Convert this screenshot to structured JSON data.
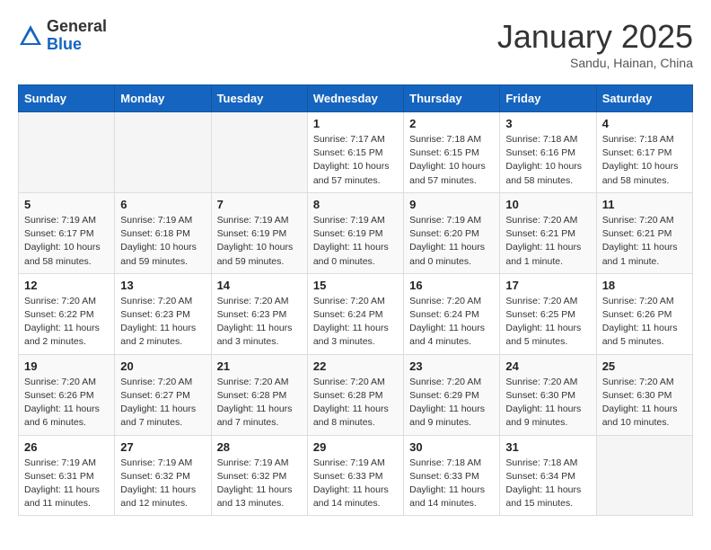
{
  "header": {
    "logo_general": "General",
    "logo_blue": "Blue",
    "month_title": "January 2025",
    "location": "Sandu, Hainan, China"
  },
  "days_of_week": [
    "Sunday",
    "Monday",
    "Tuesday",
    "Wednesday",
    "Thursday",
    "Friday",
    "Saturday"
  ],
  "weeks": [
    [
      {
        "day": "",
        "info": ""
      },
      {
        "day": "",
        "info": ""
      },
      {
        "day": "",
        "info": ""
      },
      {
        "day": "1",
        "info": "Sunrise: 7:17 AM\nSunset: 6:15 PM\nDaylight: 10 hours and 57 minutes."
      },
      {
        "day": "2",
        "info": "Sunrise: 7:18 AM\nSunset: 6:15 PM\nDaylight: 10 hours and 57 minutes."
      },
      {
        "day": "3",
        "info": "Sunrise: 7:18 AM\nSunset: 6:16 PM\nDaylight: 10 hours and 58 minutes."
      },
      {
        "day": "4",
        "info": "Sunrise: 7:18 AM\nSunset: 6:17 PM\nDaylight: 10 hours and 58 minutes."
      }
    ],
    [
      {
        "day": "5",
        "info": "Sunrise: 7:19 AM\nSunset: 6:17 PM\nDaylight: 10 hours and 58 minutes."
      },
      {
        "day": "6",
        "info": "Sunrise: 7:19 AM\nSunset: 6:18 PM\nDaylight: 10 hours and 59 minutes."
      },
      {
        "day": "7",
        "info": "Sunrise: 7:19 AM\nSunset: 6:19 PM\nDaylight: 10 hours and 59 minutes."
      },
      {
        "day": "8",
        "info": "Sunrise: 7:19 AM\nSunset: 6:19 PM\nDaylight: 11 hours and 0 minutes."
      },
      {
        "day": "9",
        "info": "Sunrise: 7:19 AM\nSunset: 6:20 PM\nDaylight: 11 hours and 0 minutes."
      },
      {
        "day": "10",
        "info": "Sunrise: 7:20 AM\nSunset: 6:21 PM\nDaylight: 11 hours and 1 minute."
      },
      {
        "day": "11",
        "info": "Sunrise: 7:20 AM\nSunset: 6:21 PM\nDaylight: 11 hours and 1 minute."
      }
    ],
    [
      {
        "day": "12",
        "info": "Sunrise: 7:20 AM\nSunset: 6:22 PM\nDaylight: 11 hours and 2 minutes."
      },
      {
        "day": "13",
        "info": "Sunrise: 7:20 AM\nSunset: 6:23 PM\nDaylight: 11 hours and 2 minutes."
      },
      {
        "day": "14",
        "info": "Sunrise: 7:20 AM\nSunset: 6:23 PM\nDaylight: 11 hours and 3 minutes."
      },
      {
        "day": "15",
        "info": "Sunrise: 7:20 AM\nSunset: 6:24 PM\nDaylight: 11 hours and 3 minutes."
      },
      {
        "day": "16",
        "info": "Sunrise: 7:20 AM\nSunset: 6:24 PM\nDaylight: 11 hours and 4 minutes."
      },
      {
        "day": "17",
        "info": "Sunrise: 7:20 AM\nSunset: 6:25 PM\nDaylight: 11 hours and 5 minutes."
      },
      {
        "day": "18",
        "info": "Sunrise: 7:20 AM\nSunset: 6:26 PM\nDaylight: 11 hours and 5 minutes."
      }
    ],
    [
      {
        "day": "19",
        "info": "Sunrise: 7:20 AM\nSunset: 6:26 PM\nDaylight: 11 hours and 6 minutes."
      },
      {
        "day": "20",
        "info": "Sunrise: 7:20 AM\nSunset: 6:27 PM\nDaylight: 11 hours and 7 minutes."
      },
      {
        "day": "21",
        "info": "Sunrise: 7:20 AM\nSunset: 6:28 PM\nDaylight: 11 hours and 7 minutes."
      },
      {
        "day": "22",
        "info": "Sunrise: 7:20 AM\nSunset: 6:28 PM\nDaylight: 11 hours and 8 minutes."
      },
      {
        "day": "23",
        "info": "Sunrise: 7:20 AM\nSunset: 6:29 PM\nDaylight: 11 hours and 9 minutes."
      },
      {
        "day": "24",
        "info": "Sunrise: 7:20 AM\nSunset: 6:30 PM\nDaylight: 11 hours and 9 minutes."
      },
      {
        "day": "25",
        "info": "Sunrise: 7:20 AM\nSunset: 6:30 PM\nDaylight: 11 hours and 10 minutes."
      }
    ],
    [
      {
        "day": "26",
        "info": "Sunrise: 7:19 AM\nSunset: 6:31 PM\nDaylight: 11 hours and 11 minutes."
      },
      {
        "day": "27",
        "info": "Sunrise: 7:19 AM\nSunset: 6:32 PM\nDaylight: 11 hours and 12 minutes."
      },
      {
        "day": "28",
        "info": "Sunrise: 7:19 AM\nSunset: 6:32 PM\nDaylight: 11 hours and 13 minutes."
      },
      {
        "day": "29",
        "info": "Sunrise: 7:19 AM\nSunset: 6:33 PM\nDaylight: 11 hours and 14 minutes."
      },
      {
        "day": "30",
        "info": "Sunrise: 7:18 AM\nSunset: 6:33 PM\nDaylight: 11 hours and 14 minutes."
      },
      {
        "day": "31",
        "info": "Sunrise: 7:18 AM\nSunset: 6:34 PM\nDaylight: 11 hours and 15 minutes."
      },
      {
        "day": "",
        "info": ""
      }
    ]
  ]
}
